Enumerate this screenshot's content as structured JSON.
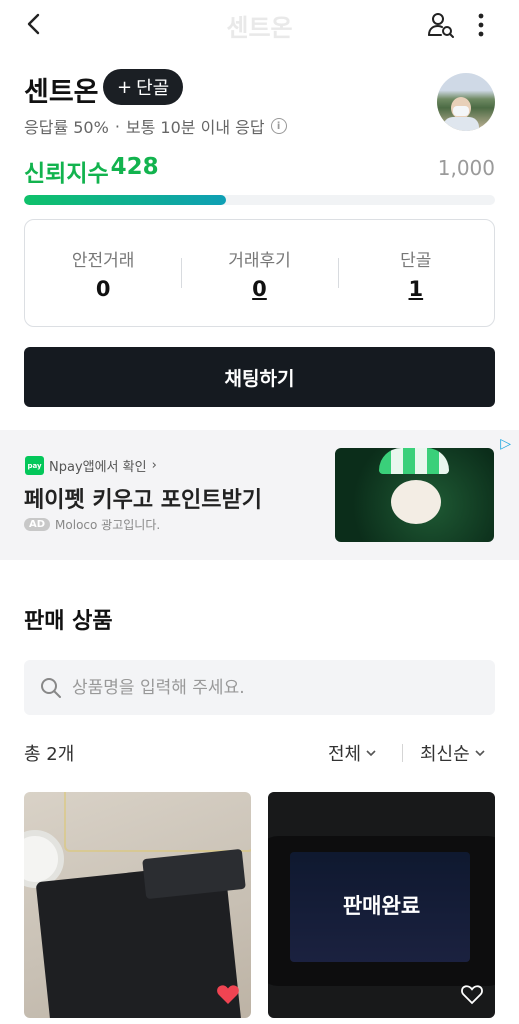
{
  "header": {
    "title": "센트온"
  },
  "profile": {
    "name": "센트온",
    "regular_button": "단골",
    "regular_plus": "+",
    "response_rate": "응답률 50%",
    "separator": "·",
    "response_time": "보통 10분 이내 응답"
  },
  "trust": {
    "label": "신뢰지수",
    "score": "428",
    "max": "1,000",
    "fill_fraction": 0.428
  },
  "stats": [
    {
      "label": "안전거래",
      "value": "0"
    },
    {
      "label": "거래후기",
      "value": "0"
    },
    {
      "label": "단골",
      "value": "1"
    }
  ],
  "chat_button": "채팅하기",
  "ad": {
    "source": "Npay앱에서 확인",
    "source_chevron": "›",
    "title": "페이펫 키우고 포인트받기",
    "tag": "AD",
    "sponsor": "Moloco 광고입니다.",
    "npay_badge": "pay",
    "choice_icon": "▷"
  },
  "products_section": {
    "title": "판매 상품",
    "search_placeholder": "상품명을 입력해 주세요.",
    "count": "총 2개",
    "filter": "전체",
    "sort": "최신순",
    "items": [
      {
        "status": "",
        "liked": true
      },
      {
        "status": "판매완료",
        "liked": false
      }
    ]
  },
  "colors": {
    "trust_green": "#12b34e",
    "heart_red": "#f04452",
    "dark": "#151a20"
  }
}
